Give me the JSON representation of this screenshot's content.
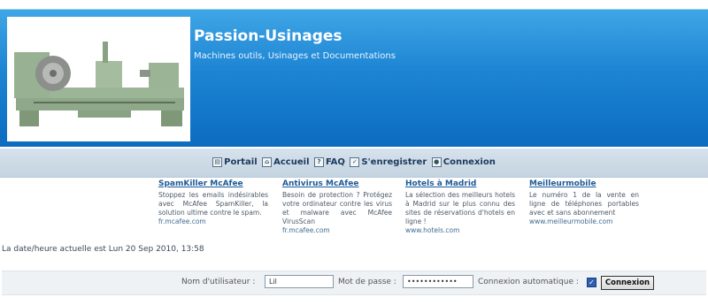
{
  "header": {
    "title": "Passion-Usinages",
    "subtitle": "Machines outils, Usinages et Documentations",
    "logo_icon": "lathe-machine-image"
  },
  "nav": {
    "items": [
      {
        "label": "Portail",
        "icon": "portal-icon"
      },
      {
        "label": "Accueil",
        "icon": "home-icon"
      },
      {
        "label": "FAQ",
        "icon": "faq-icon"
      },
      {
        "label": "S'enregistrer",
        "icon": "register-icon"
      },
      {
        "label": "Connexion",
        "icon": "login-icon"
      }
    ]
  },
  "ads": [
    {
      "title": "SpamKiller McAfee",
      "desc": "Stoppez les emails indésirables avec McAfee SpamKiller, la solution ultime contre le spam.",
      "url": "fr.mcafee.com"
    },
    {
      "title": "Antivirus McAfee",
      "desc": "Besoin de protection ? Protégez votre ordinateur contre les virus et malware avec McAfee VirusScan",
      "url": "fr.mcafee.com"
    },
    {
      "title": "Hotels à Madrid",
      "desc": "La sélection des meilleurs hotels à Madrid sur le plus connu des sites de réservations d'hotels en ligne !",
      "url": "www.hotels.com"
    },
    {
      "title": "Meilleurmobile",
      "desc": "Le numéro 1 de la vente en ligne de téléphones portables avec et sans abonnement",
      "url": "www.meilleurmobile.com"
    }
  ],
  "date_line": "La date/heure actuelle est Lun 20 Sep 2010, 13:58",
  "login": {
    "username_label": "Nom d'utilisateur :",
    "username_value": "Lil",
    "password_label": "Mot de passe :",
    "password_value": "••••••••••••",
    "auto_label": "Connexion automatique :",
    "auto_checked": "✓",
    "submit_label": "Connexion"
  },
  "colors": {
    "header_blue": "#1d84d3",
    "nav_bg": "#c5d4e1",
    "link_blue": "#1d5a99"
  }
}
